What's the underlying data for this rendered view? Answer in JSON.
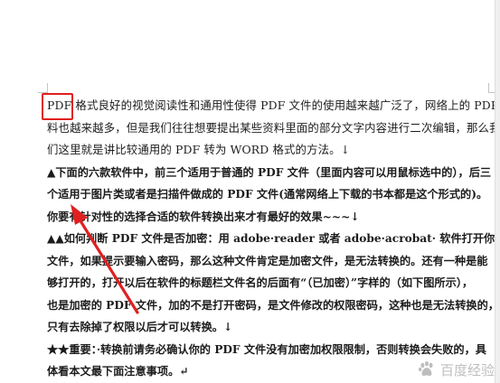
{
  "document": {
    "lines": [
      {
        "text": "PDF 格式良好的视觉阅读性和通用性使得 PDF 文件的使用越来越广泛了，网络上的 PDF 资",
        "bold": false
      },
      {
        "text": "料也越来越多，但是我们往往想要提出某些资料里面的部分文字内容进行二次编辑，那么我",
        "bold": false
      },
      {
        "text": "们这里就是讲比较通用的 PDF 转为 WORD 格式的方法。↓",
        "bold": false
      },
      {
        "text": "▲下面的六款软件中，前三个适用于普通的 PDF 文件（里面内容可以用鼠标选中的），后三",
        "bold": true
      },
      {
        "text": "个适用于图片类或者是扫描件做成的 PDF 文件(通常网络上下载的书本都是这个形式的)。",
        "bold": true
      },
      {
        "text": "你要有针对性的选择合适的软件转换出来才有最好的效果~~~↓",
        "bold": true
      },
      {
        "text": "▲▲如何判断 PDF 文件是否加密：用 adobe·reader 或者 adobe·acrobat· 软件打开你的 PDF",
        "bold": true
      },
      {
        "text": "文件，如果提示要输入密码，那么这种文件肯定是加密文件，是无法转换的。还有一种是能",
        "bold": true
      },
      {
        "text": "够打开的，打开以后在软件的标题栏文件名的后面有“（已加密）”字样的（如下图所示），",
        "bold": true
      },
      {
        "text": "也是加密的 PDF 文件，加的不是打开密码，是文件修改的权限密码，这种也是无法转换的，",
        "bold": true
      },
      {
        "text": "只有去除掉了权限以后才可以转换。↓",
        "bold": true
      },
      {
        "text": "★★重要：·转换前请务必确认你的 PDF 文件没有加密加权限限制，否则转换会失败的，具",
        "bold": true
      },
      {
        "text": "体看本文最下面注意事项。↵",
        "bold": true
      }
    ]
  },
  "watermark": {
    "text": "百度经验",
    "icon": "baidu-paw-icon"
  },
  "annotation": {
    "color": "#e02020"
  }
}
